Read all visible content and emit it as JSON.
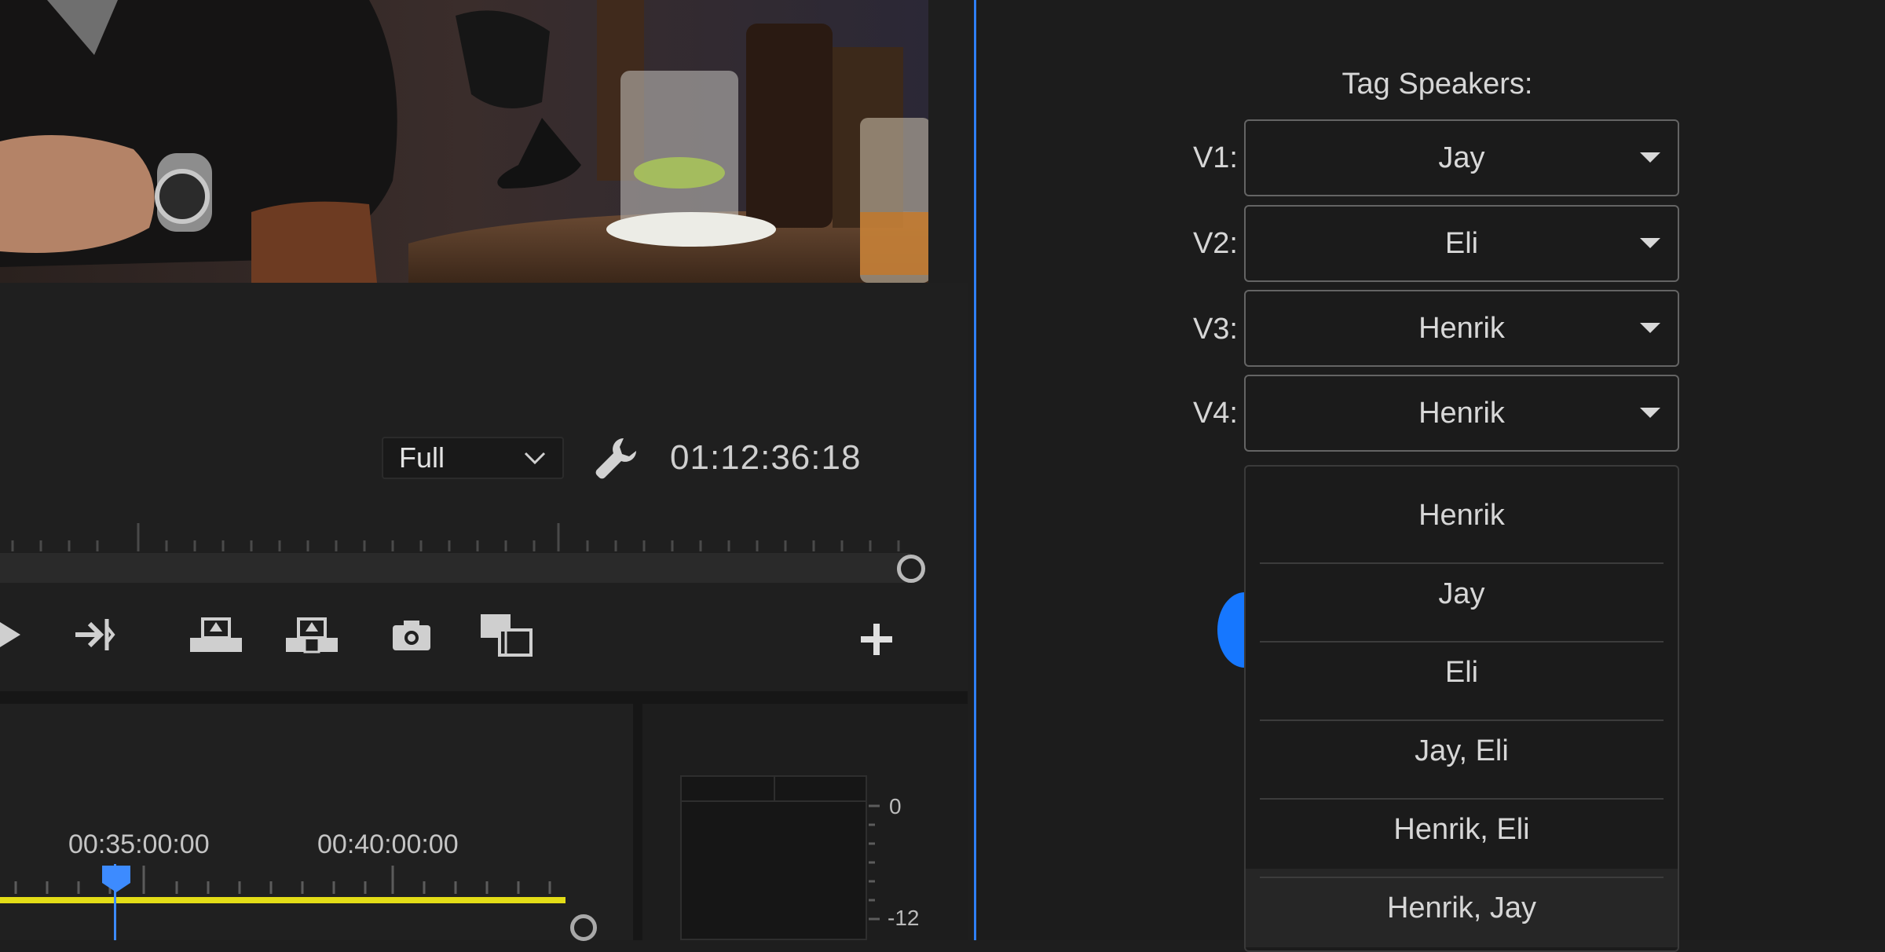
{
  "monitor": {
    "quality": "Full",
    "timecode": "01:12:36:18"
  },
  "timeline": {
    "time_marks": [
      "00:35:00:00",
      "00:40:00:00"
    ]
  },
  "audio_meter": {
    "scale": [
      "0",
      "-12"
    ]
  },
  "tag_speakers": {
    "title": "Tag Speakers:",
    "rows": [
      {
        "label": "V1:",
        "value": "Jay"
      },
      {
        "label": "V2:",
        "value": "Eli"
      },
      {
        "label": "V3:",
        "value": "Henrik"
      },
      {
        "label": "V4:",
        "value": "Henrik"
      }
    ],
    "dropdown_options": [
      "Henrik",
      "Jay",
      "Eli",
      "Jay, Eli",
      "Henrik, Eli",
      "Henrik, Jay"
    ],
    "highlighted_option": "Henrik, Jay"
  },
  "colors": {
    "accent_blue": "#2f7ff5",
    "playhead_blue": "#3d8bff",
    "timeline_yellow": "#e3dd17"
  },
  "icons": [
    "play-icon",
    "go-to-out-icon",
    "lift-icon",
    "extract-icon",
    "camera-icon",
    "comparison-view-icon",
    "add-icon",
    "wrench-icon",
    "chevron-down-icon"
  ]
}
